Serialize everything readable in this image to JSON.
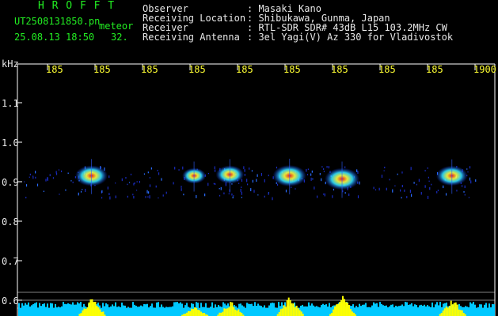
{
  "logo": "H R O F F T",
  "file": {
    "name": "UT2508131850.pn",
    "suffix": "meteor",
    "datetime": "25.08.13 18:50",
    "count": "32."
  },
  "info": [
    {
      "label": "Observer",
      "value": ": Masaki Kano"
    },
    {
      "label": "Receiving Location",
      "value": ": Shibukawa, Gunma, Japan"
    },
    {
      "label": "Receiver",
      "value": ": RTL-SDR SDR# 43dB L15 103.2MHz CW"
    },
    {
      "label": "Receiving Antenna",
      "value": ": 3el Yagi(V) Az 330 for Vladivostok"
    }
  ],
  "axis": {
    "unit": "kHz",
    "x_ticks": [
      "185",
      "185",
      "185",
      "185",
      "185",
      "185",
      "185",
      "185",
      "185",
      "1900"
    ],
    "y_ticks": [
      "1.1",
      "1.0",
      "0.9",
      "0.8",
      "0.7",
      "0.6"
    ]
  },
  "colors": {
    "grid": "#ffffff",
    "ticks": "#ffff33",
    "header": "#22ee22",
    "activity": "#ffff00",
    "activity_base": "#00c8ff"
  },
  "echoes": [
    {
      "time_frac": 0.155,
      "freq_khz": 0.915,
      "strength": 0.9
    },
    {
      "time_frac": 0.37,
      "freq_khz": 0.915,
      "strength": 0.5
    },
    {
      "time_frac": 0.445,
      "freq_khz": 0.918,
      "strength": 0.7
    },
    {
      "time_frac": 0.57,
      "freq_khz": 0.915,
      "strength": 0.95
    },
    {
      "time_frac": 0.68,
      "freq_khz": 0.907,
      "strength": 1.0
    },
    {
      "time_frac": 0.91,
      "freq_khz": 0.915,
      "strength": 0.85
    }
  ]
}
